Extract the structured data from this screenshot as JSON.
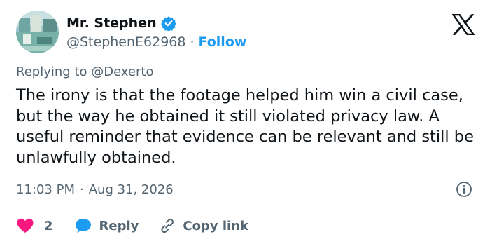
{
  "author": {
    "display_name": "Mr. Stephen",
    "handle": "@StephenE62968",
    "separator": "·",
    "follow_label": "Follow",
    "verified": true
  },
  "reply_context": {
    "prefix": "Replying to ",
    "target": "@Dexerto"
  },
  "tweet": {
    "text": "The irony is that the footage helped him win a civil case, but the way he obtained it still violated privacy law. A useful reminder that evidence can be relevant and still be unlawfully obtained.",
    "time": "11:03 PM",
    "separator": "·",
    "date": "Aug 31, 2026"
  },
  "actions": {
    "like_count": "2",
    "reply_label": "Reply",
    "copy_link_label": "Copy link"
  },
  "icons": {
    "logo": "x-logo-icon",
    "verified": "verified-badge-icon",
    "info": "info-icon",
    "like": "heart-icon",
    "reply": "reply-bubble-icon",
    "copy": "link-icon"
  },
  "colors": {
    "accent": "#1d9bf0",
    "like": "#f91880",
    "text": "#0f1419",
    "secondary": "#536471",
    "divider": "#cfd9de"
  }
}
